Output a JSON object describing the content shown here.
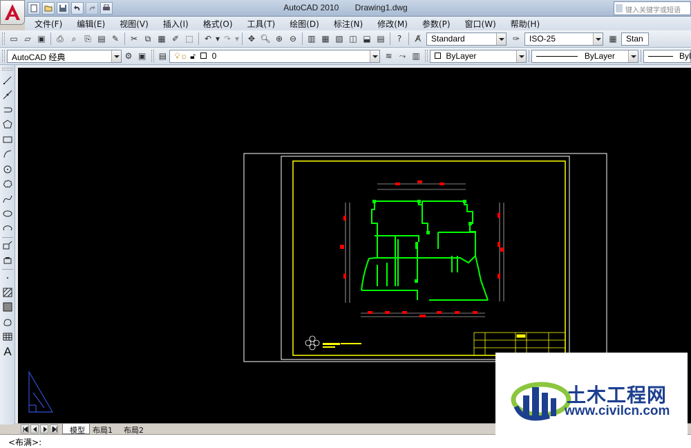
{
  "window": {
    "app_title": "AutoCAD 2010",
    "file_name": "Drawing1.dwg",
    "search_placeholder": "键入关键字或短语"
  },
  "quick_access": {
    "icons": [
      "new-file-icon",
      "open-file-icon",
      "save-icon",
      "undo-icon",
      "redo-icon",
      "plot-icon"
    ]
  },
  "menu": {
    "items": [
      "文件(F)",
      "编辑(E)",
      "视图(V)",
      "插入(I)",
      "格式(O)",
      "工具(T)",
      "绘图(D)",
      "标注(N)",
      "修改(M)",
      "参数(P)",
      "窗口(W)",
      "帮助(H)"
    ]
  },
  "standard_toolbar": {
    "text_style": "Standard",
    "dim_style": "ISO-25",
    "table_style": "Stan"
  },
  "workspace_toolbar": {
    "workspace": "AutoCAD 经典",
    "current_layer": "0",
    "color": "ByLayer",
    "linetype": "ByLayer",
    "lineweight": "ByL"
  },
  "draw_toolbar": {
    "text_tool": "A"
  },
  "layout_tabs": {
    "tabs": [
      "模型",
      "布局1",
      "布局2"
    ],
    "active": "布局1"
  },
  "command_line": {
    "text": "<布满>:"
  },
  "watermark": {
    "title": "土木工程网",
    "url": "www.civilcn.com"
  },
  "colors": {
    "canvas": "#000000",
    "paper_border": "#ffffff",
    "title_block": "#ffff00",
    "walls": "#00ff00",
    "dimensions": "#ff0000",
    "brand_blue": "#1d3f8f"
  }
}
